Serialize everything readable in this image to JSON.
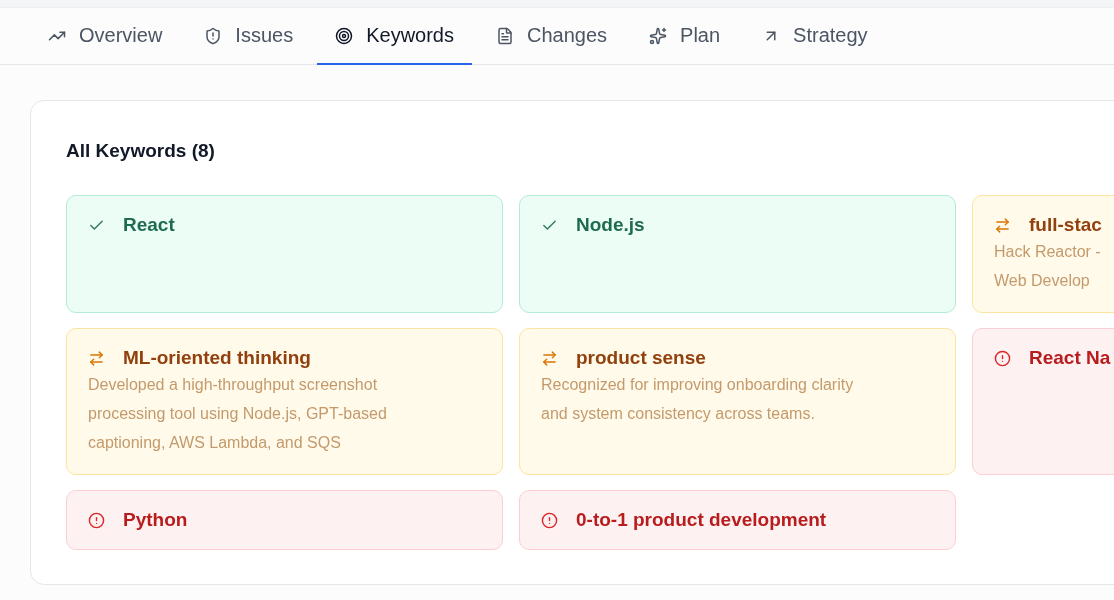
{
  "tabs": [
    {
      "label": "Overview",
      "selected": false
    },
    {
      "label": "Issues",
      "selected": false
    },
    {
      "label": "Keywords",
      "selected": true
    },
    {
      "label": "Changes",
      "selected": false
    },
    {
      "label": "Plan",
      "selected": false
    },
    {
      "label": "Strategy",
      "selected": false
    }
  ],
  "keywords_panel": {
    "title": "All Keywords (8)",
    "keywords": [
      {
        "kind": "matched",
        "label": "React"
      },
      {
        "kind": "matched",
        "label": "Node.js"
      },
      {
        "kind": "partial",
        "label": "full-stac",
        "description_lines": [
          "Hack Reactor -",
          "Web Develop"
        ]
      },
      {
        "kind": "partial",
        "label": "ML-oriented thinking",
        "description_lines": [
          "Developed a high-throughput screenshot",
          "processing tool using Node.js, GPT-based",
          "captioning, AWS Lambda, and SQS"
        ]
      },
      {
        "kind": "partial",
        "label": "product sense",
        "description_lines": [
          "Recognized for improving onboarding clarity",
          "and system consistency across teams."
        ]
      },
      {
        "kind": "missing",
        "label": "React Na"
      },
      {
        "kind": "missing",
        "label": "Python"
      },
      {
        "kind": "missing",
        "label": "0-to-1 product development"
      }
    ]
  }
}
